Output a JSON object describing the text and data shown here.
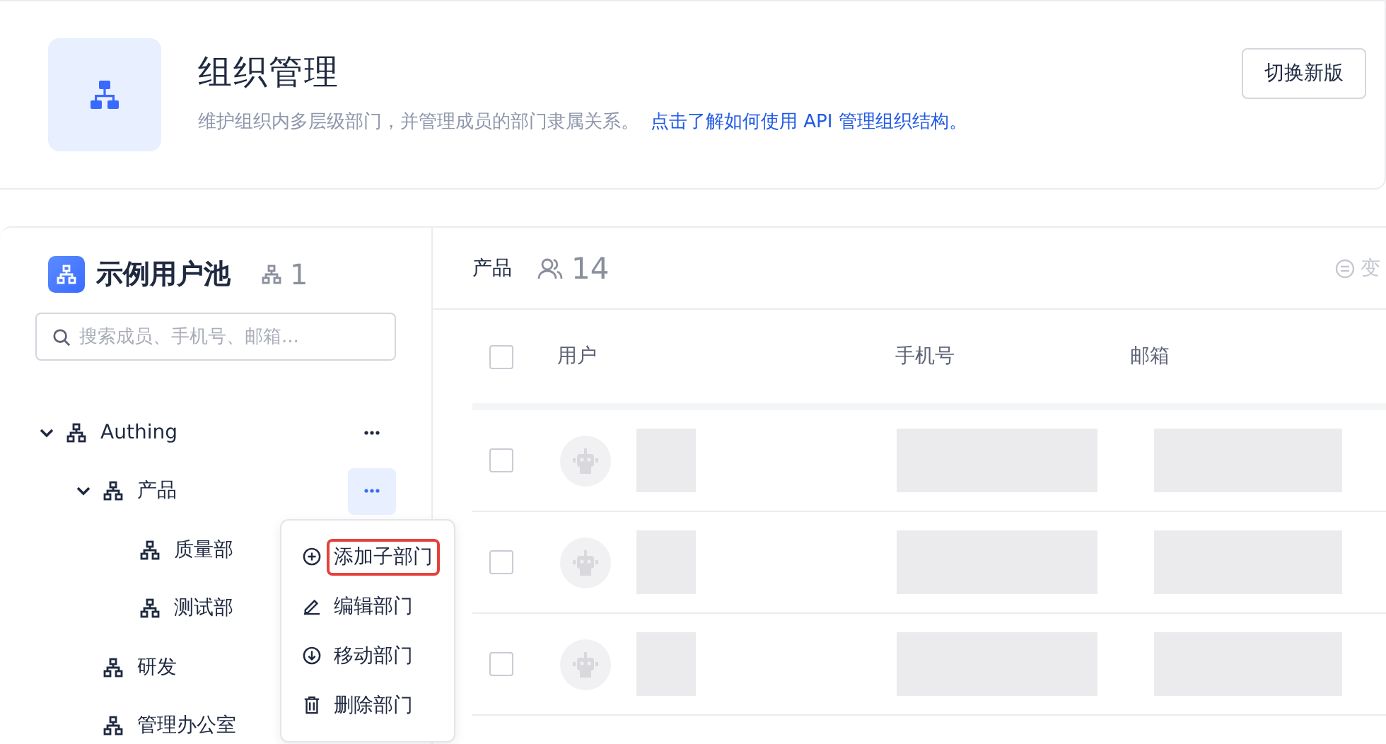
{
  "header": {
    "title": "组织管理",
    "description": "维护组织内多层级部门，并管理成员的部门隶属关系。",
    "link": "点击了解如何使用 API 管理组织结构。",
    "button": "切换新版"
  },
  "pool": {
    "name": "示例用户池",
    "dept_count": "1",
    "search_placeholder": "搜索成员、手机号、邮箱..."
  },
  "tree": [
    {
      "label": "Authing",
      "expanded": true,
      "actions": {
        "open": false
      },
      "children": [
        {
          "label": "产品",
          "expanded": true,
          "actions": {
            "open": true
          },
          "children": [
            {
              "label": "质量部"
            },
            {
              "label": "测试部"
            }
          ]
        },
        {
          "label": "研发"
        },
        {
          "label": "管理办公室"
        }
      ]
    }
  ],
  "menu": [
    {
      "label": "添加子部门",
      "kind": "add",
      "highlighted": true
    },
    {
      "label": "编辑部门",
      "kind": "edit",
      "highlighted": false
    },
    {
      "label": "移动部门",
      "kind": "move",
      "highlighted": false
    },
    {
      "label": "删除部门",
      "kind": "delete",
      "highlighted": false
    }
  ],
  "detail": {
    "department": "产品",
    "member_count": "14",
    "action": "变"
  },
  "table": {
    "columns": [
      "用户",
      "手机号",
      "邮箱"
    ],
    "header_checked": false,
    "rows": [
      {
        "checked": false
      },
      {
        "checked": false
      },
      {
        "checked": false
      }
    ]
  }
}
